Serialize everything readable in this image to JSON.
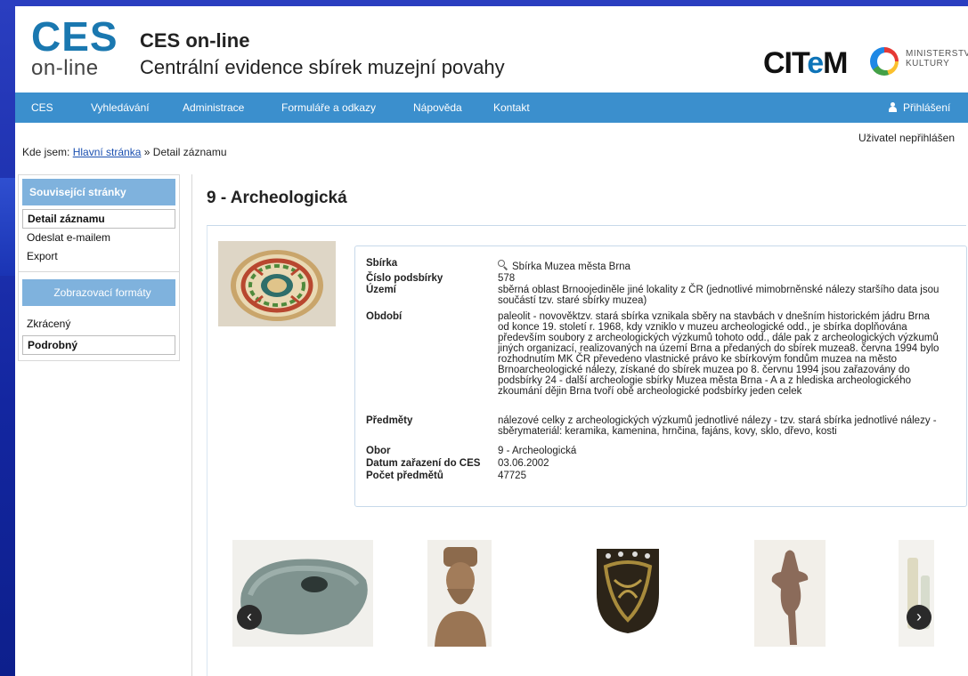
{
  "header": {
    "logo_top": "CES",
    "logo_bottom": "on-line",
    "title": "CES on-line",
    "subtitle": "Centrální evidence sbírek muzejní povahy",
    "partner1": "CITeM",
    "partner2_line1": "MINISTERSTV",
    "partner2_line2": "KULTURY"
  },
  "nav": {
    "items": [
      "CES",
      "Vyhledávání",
      "Administrace",
      "Formuláře a odkazy",
      "Nápověda",
      "Kontakt"
    ],
    "login_label": "Přihlášení"
  },
  "user_status": "Uživatel nepřihlášen",
  "breadcrumb": {
    "prefix": "Kde jsem:",
    "home": "Hlavní stránka",
    "sep": "»",
    "current": "Detail záznamu"
  },
  "sidebar": {
    "related_title": "Související stránky",
    "related_items": [
      "Detail záznamu",
      "Odeslat e-mailem",
      "Export"
    ],
    "formats_title": "Zobrazovací formáty",
    "format_items": [
      "Zkrácený",
      "Podrobný"
    ]
  },
  "record": {
    "title": "9 - Archeologická",
    "fields": [
      {
        "label": "Sbírka",
        "value": "Sbírka Muzea města Brna"
      },
      {
        "label": "Číslo podsbírky",
        "value": "578"
      },
      {
        "label": "Území",
        "value": "sběrná oblast Brnoojediněle jiné lokality z ČR (jednotlivé mimobrněnské nálezy staršího data jsou součástí tzv. staré sbírky muzea)"
      },
      {
        "label": "Období",
        "value": "paleolit - novověktzv. stará sbírka vznikala sběry na stavbách v dnešním historickém jádru Brna od konce 19. století r. 1968, kdy vzniklo v muzeu archeologické odd., je sbírka doplňována především soubory z archeologických výzkumů tohoto odd., dále pak z archeologických výzkumů jiných organizací, realizovaných na území Brna a předaných do sbírek muzea8. června 1994 bylo rozhodnutím MK ČR převedeno vlastnické právo ke sbírkovým fondům muzea na město Brnoarcheologické nálezy, získané do sbírek muzea po 8. červnu 1994 jsou zařazovány do podsbírky 24 - další archeologie sbírky Muzea města Brna - A a z hlediska archeologického zkoumání dějin Brna tvoří obě archeologické podsbírky jeden celek"
      },
      {
        "label": "Předměty",
        "value": "nálezové celky z archeologických výzkumů jednotlivé nálezy - tzv. stará sbírka jednotlivé nálezy - sběrymateriál: keramika, kamenina, hrnčina, fajáns, kovy, sklo, dřevo, kosti"
      },
      {
        "label": "Obor",
        "value": "9 - Archeologická"
      },
      {
        "label": "Datum zařazení do CES",
        "value": "03.06.2002"
      },
      {
        "label": "Počet předmětů",
        "value": "47725"
      }
    ]
  },
  "gallery": {
    "prev": "‹",
    "next": "›"
  }
}
